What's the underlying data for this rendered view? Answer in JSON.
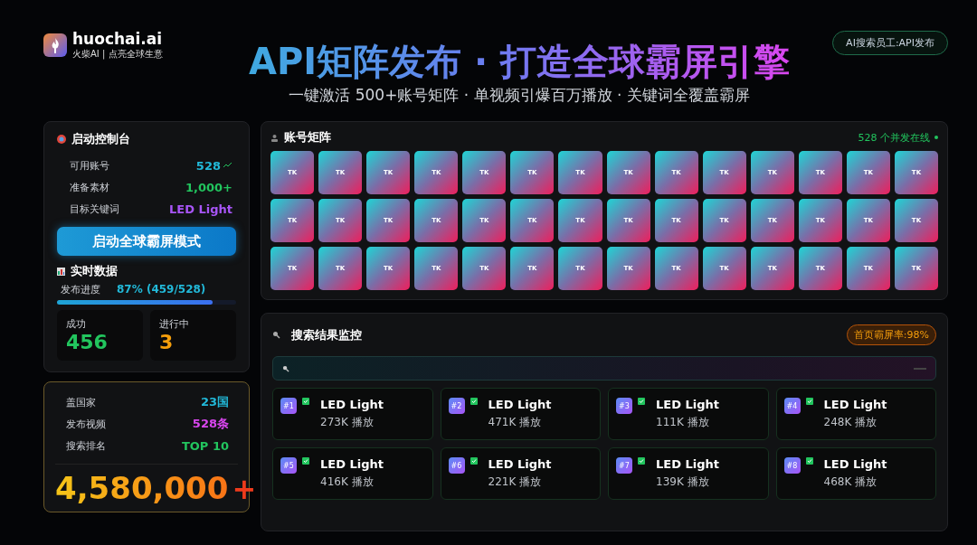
{
  "brand": {
    "name": "huochai.ai",
    "tagline": "火柴AI | 点亮全球生意"
  },
  "header": {
    "title": "API矩阵发布 · 打造全球霸屏引擎",
    "subtitle": "一键激活 500+账号矩阵 · 单视频引爆百万播放 · 关键词全覆盖霸屏",
    "badge": "AI搜索员工:API发布"
  },
  "control_panel": {
    "title": "启动控制台",
    "stats": [
      {
        "label": "可用账号",
        "value": "528",
        "color": "#22b8d8",
        "trend": true
      },
      {
        "label": "准备素材",
        "value": "1,000+",
        "color": "#22c55e",
        "trend": false
      },
      {
        "label": "目标关键词",
        "value": "LED Light",
        "color": "#a855f7",
        "trend": false
      }
    ],
    "start_button": "启动全球霸屏模式",
    "realtime_title": "实时数据",
    "progress": {
      "label": "发布进度",
      "reading": "87% (459/528)",
      "level": 0.87
    },
    "counters": [
      {
        "label": "成功",
        "value": "456",
        "color": "#22c55e"
      },
      {
        "label": "进行中",
        "value": "3",
        "color": "#f59e0b"
      }
    ]
  },
  "summary_panel": {
    "stats": [
      {
        "label": "盖国家",
        "value": "23国",
        "color": "#22b8d8"
      },
      {
        "label": "发布视频",
        "value": "528条",
        "color": "#d946ef"
      },
      {
        "label": "搜索排名",
        "value": "TOP 10",
        "color": "#22c55e"
      }
    ],
    "total": "4,580,000",
    "total_suffix": "+"
  },
  "account_matrix": {
    "title": "账号矩阵",
    "status": "528 个并发在线",
    "tiles": [
      {
        "label": "TK"
      },
      {
        "label": "TK"
      },
      {
        "label": "TK"
      },
      {
        "label": "TK"
      },
      {
        "label": "TK"
      },
      {
        "label": "TK"
      },
      {
        "label": "TK"
      },
      {
        "label": "TK"
      },
      {
        "label": "TK"
      },
      {
        "label": "TK"
      },
      {
        "label": "TK"
      },
      {
        "label": "TK"
      },
      {
        "label": "TK"
      },
      {
        "label": "TK"
      },
      {
        "label": "TK"
      },
      {
        "label": "TK"
      },
      {
        "label": "TK"
      },
      {
        "label": "TK"
      },
      {
        "label": "TK"
      },
      {
        "label": "TK"
      },
      {
        "label": "TK"
      },
      {
        "label": "TK"
      },
      {
        "label": "TK"
      },
      {
        "label": "TK"
      },
      {
        "label": "TK"
      },
      {
        "label": "TK"
      },
      {
        "label": "TK"
      },
      {
        "label": "TK"
      },
      {
        "label": "TK"
      },
      {
        "label": "TK"
      },
      {
        "label": "TK"
      },
      {
        "label": "TK"
      },
      {
        "label": "TK"
      },
      {
        "label": "TK"
      },
      {
        "label": "TK"
      },
      {
        "label": "TK"
      },
      {
        "label": "TK"
      },
      {
        "label": "TK"
      },
      {
        "label": "TK"
      },
      {
        "label": "TK"
      },
      {
        "label": "TK"
      },
      {
        "label": "TK"
      }
    ]
  },
  "search_monitor": {
    "title": "搜索结果监控",
    "rate_badge": "首页霸屏率:98%",
    "results": [
      {
        "rank": "#1",
        "title": "LED Light",
        "plays": "273K 播放",
        "checked": true
      },
      {
        "rank": "#2",
        "title": "LED Light",
        "plays": "471K 播放",
        "checked": true
      },
      {
        "rank": "#3",
        "title": "LED Light",
        "plays": "111K 播放",
        "checked": true
      },
      {
        "rank": "#4",
        "title": "LED Light",
        "plays": "248K 播放",
        "checked": true
      },
      {
        "rank": "#5",
        "title": "LED Light",
        "plays": "416K 播放",
        "checked": true
      },
      {
        "rank": "#6",
        "title": "LED Light",
        "plays": "221K 播放",
        "checked": true
      },
      {
        "rank": "#7",
        "title": "LED Light",
        "plays": "139K 播放",
        "checked": true
      },
      {
        "rank": "#8",
        "title": "LED Light",
        "plays": "468K 播放",
        "checked": true
      }
    ]
  }
}
